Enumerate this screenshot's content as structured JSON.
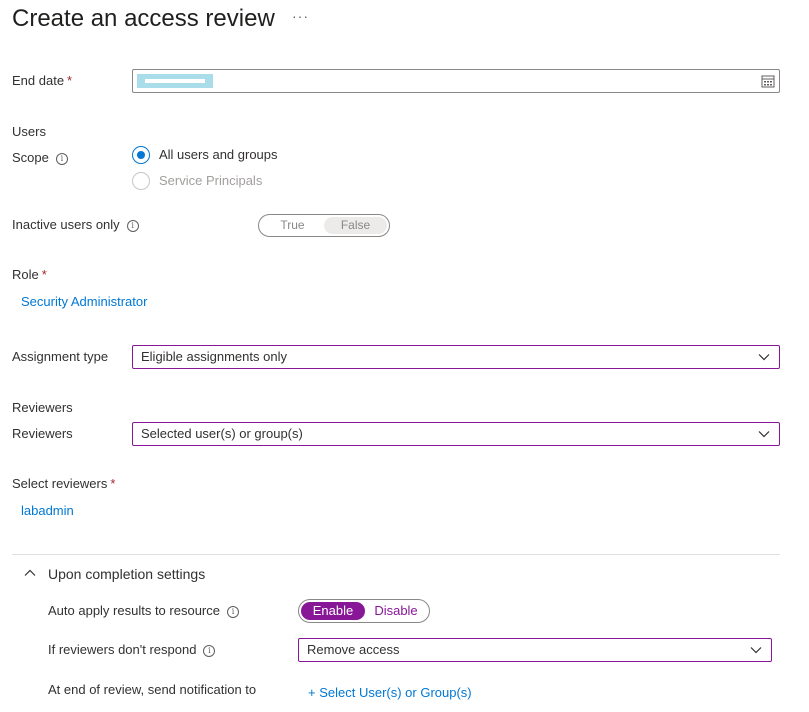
{
  "page": {
    "title": "Create an access review",
    "more_label": "···"
  },
  "end_date": {
    "label": "End date",
    "required_mark": "*",
    "value": "",
    "calendar_icon": "calendar-icon"
  },
  "users": {
    "section_label": "Users",
    "scope_label": "Scope",
    "scope_options": [
      {
        "label": "All users and groups",
        "selected": true,
        "enabled": true
      },
      {
        "label": "Service Principals",
        "selected": false,
        "enabled": false
      }
    ],
    "inactive_label": "Inactive users only",
    "inactive_toggle": {
      "true_label": "True",
      "false_label": "False",
      "selected": "False"
    }
  },
  "role": {
    "label": "Role",
    "required_mark": "*",
    "value_link": "Security Administrator"
  },
  "assignment_type": {
    "label": "Assignment type",
    "selected": "Eligible assignments only"
  },
  "reviewers": {
    "section_label": "Reviewers",
    "label": "Reviewers",
    "selected": "Selected user(s) or group(s)",
    "select_label": "Select reviewers",
    "required_mark": "*",
    "selected_link": "labadmin"
  },
  "completion": {
    "header": "Upon completion settings",
    "expanded": true,
    "auto_apply_label": "Auto apply results to resource",
    "auto_apply_toggle": {
      "enable_label": "Enable",
      "disable_label": "Disable",
      "selected": "Enable"
    },
    "no_response_label": "If reviewers don't respond",
    "no_response_selected": "Remove access",
    "notify_label": "At end of review, send notification to",
    "notify_link": "+ Select User(s) or Group(s)"
  },
  "colors": {
    "accent_blue": "#0078d4",
    "accent_purple": "#881798",
    "required_red": "#a4262c"
  }
}
